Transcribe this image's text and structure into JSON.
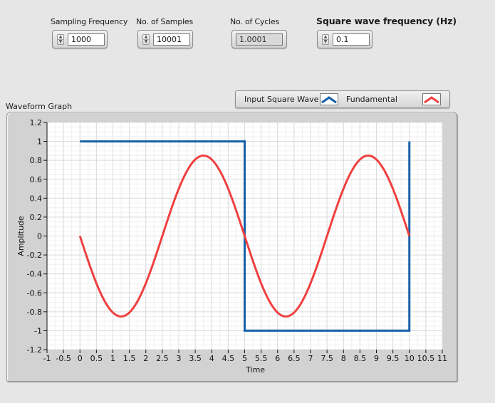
{
  "controls": [
    {
      "label": "Sampling Frequency",
      "value": "1000",
      "type": "control"
    },
    {
      "label": "No. of Samples",
      "value": "10001",
      "type": "control"
    },
    {
      "label": "No. of Cycles",
      "value": "1.0001",
      "type": "indicator"
    },
    {
      "label": "Square wave frequency (Hz)",
      "value": "0.1",
      "type": "control"
    }
  ],
  "legend": {
    "items": [
      {
        "label": "Input Square Wave",
        "color": "#1560a8"
      },
      {
        "label": "Fundamental",
        "color": "#f04040"
      }
    ]
  },
  "graph": {
    "label": "Waveform Graph"
  },
  "chart_data": {
    "type": "line",
    "title": "Waveform Graph",
    "xlabel": "Time",
    "ylabel": "Amplitude",
    "xlim": [
      -1,
      11
    ],
    "ylim": [
      -1.2,
      1.2
    ],
    "grid": true,
    "x_ticks": [
      "-1",
      "-0.5",
      "0",
      "0.5",
      "1",
      "1.5",
      "2",
      "2.5",
      "3",
      "3.5",
      "4",
      "4.5",
      "5",
      "5.5",
      "6",
      "6.5",
      "7",
      "7.5",
      "8",
      "8.5",
      "9",
      "9.5",
      "10",
      "10.5",
      "11"
    ],
    "y_ticks": [
      "1.2",
      "1",
      "0.8",
      "0.6",
      "0.4",
      "0.2",
      "0",
      "-0.2",
      "-0.4",
      "-0.6",
      "-0.8",
      "-1",
      "-1.2"
    ],
    "legend_position": "top-right",
    "series": [
      {
        "name": "Input Square Wave",
        "color": "#1560a8",
        "x": [
          0,
          5,
          5,
          10,
          10
        ],
        "y": [
          1,
          1,
          -1,
          -1,
          1
        ]
      },
      {
        "name": "Fundamental",
        "color": "#f04040",
        "function": "-0.85*sin(2*pi*0.2*t)",
        "x_range": [
          0,
          10
        ],
        "amplitude": -0.85,
        "frequency_hz": 0.2
      }
    ]
  }
}
